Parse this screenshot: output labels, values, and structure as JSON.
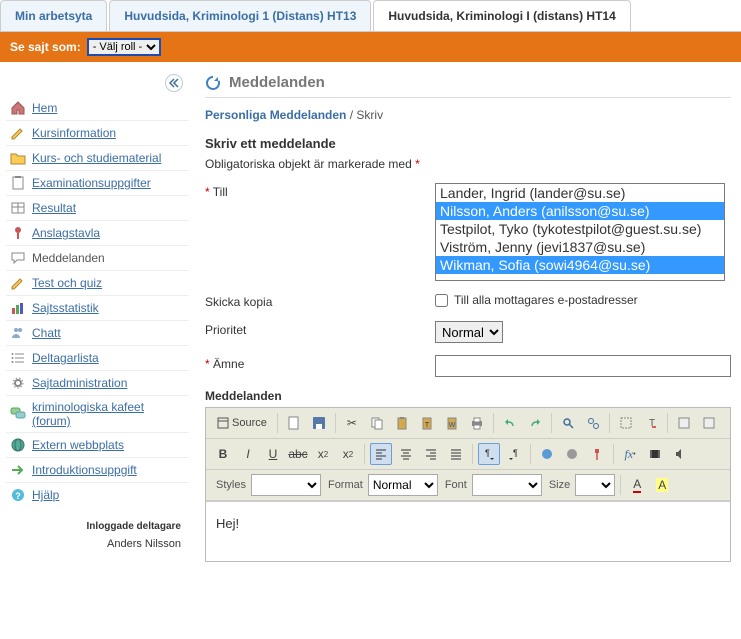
{
  "tabs": [
    {
      "label": "Min arbetsyta",
      "active": false
    },
    {
      "label": "Huvudsida, Kriminologi 1 (Distans) HT13",
      "active": false
    },
    {
      "label": "Huvudsida, Kriminologi I (distans) HT14",
      "active": true
    }
  ],
  "rolebar": {
    "label": "Se sajt som:",
    "value": "- Välj roll -"
  },
  "sidebar": {
    "items": [
      {
        "label": "Hem",
        "icon": "home"
      },
      {
        "label": "Kursinformation",
        "icon": "pencil"
      },
      {
        "label": "Kurs- och studiematerial",
        "icon": "folder"
      },
      {
        "label": "Examinationsuppgifter",
        "icon": "clipboard"
      },
      {
        "label": "Resultat",
        "icon": "table"
      },
      {
        "label": "Anslagstavla",
        "icon": "pin"
      },
      {
        "label": "Meddelanden",
        "icon": "bubble",
        "current": true
      },
      {
        "label": "Test och quiz",
        "icon": "pencil2"
      },
      {
        "label": "Sajtsstatistik",
        "icon": "bars"
      },
      {
        "label": "Chatt",
        "icon": "people"
      },
      {
        "label": "Deltagarlista",
        "icon": "list"
      },
      {
        "label": "Sajtadministration",
        "icon": "gears"
      },
      {
        "label": "kriminologiska kafeet (forum)",
        "icon": "forum"
      },
      {
        "label": "Extern webbplats",
        "icon": "globe"
      },
      {
        "label": "Introduktionsuppgift",
        "icon": "arrow"
      },
      {
        "label": "Hjälp",
        "icon": "help"
      }
    ]
  },
  "loggedIn": {
    "label": "Inloggade deltagare",
    "name": "Anders Nilsson"
  },
  "page": {
    "title": "Meddelanden",
    "breadcrumb": {
      "root": "Personliga Meddelanden",
      "sep": "/",
      "current": "Skriv"
    },
    "sectionTitle": "Skriv ett meddelande",
    "requiredNote": "Obligatoriska objekt är markerade med",
    "form": {
      "toLabel": "Till",
      "recipients": [
        {
          "text": "Lander, Ingrid (lander@su.se)",
          "selected": false
        },
        {
          "text": "Nilsson, Anders (anilsson@su.se)",
          "selected": true
        },
        {
          "text": "Testpilot, Tyko (tykotestpilot@guest.su.se)",
          "selected": false
        },
        {
          "text": "Viström, Jenny (jevi1837@su.se)",
          "selected": false
        },
        {
          "text": "Wikman, Sofia (sowi4964@su.se)",
          "selected": true
        }
      ],
      "ccLabel": "Skicka kopia",
      "ccCheckbox": "Till alla mottagares e-postadresser",
      "priorityLabel": "Prioritet",
      "priorityValue": "Normal",
      "subjectLabel": "Ämne",
      "subjectValue": ""
    },
    "editor": {
      "label": "Meddelanden",
      "sourceBtn": "Source",
      "stylesLabel": "Styles",
      "formatLabel": "Format",
      "formatValue": "Normal",
      "fontLabel": "Font",
      "sizeLabel": "Size",
      "body": "Hej!"
    }
  }
}
